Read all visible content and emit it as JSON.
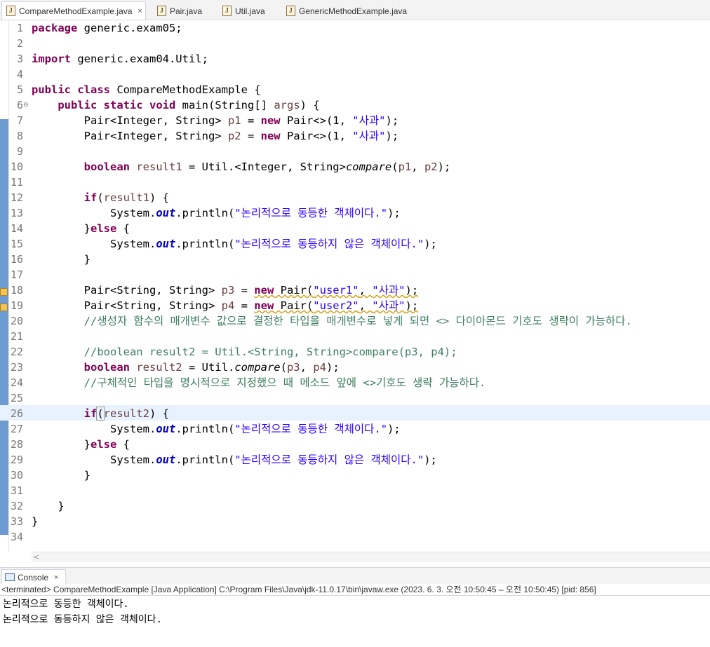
{
  "tabs": [
    {
      "label": "CompareMethodExample.java",
      "active": true,
      "close": "×"
    },
    {
      "label": "Pair.java",
      "active": false
    },
    {
      "label": "Util.java",
      "active": false
    },
    {
      "label": "GenericMethodExample.java",
      "active": false
    }
  ],
  "editor": {
    "line_numbers": [
      "1",
      "2",
      "3",
      "4",
      "5",
      "6",
      "7",
      "8",
      "9",
      "10",
      "11",
      "12",
      "13",
      "14",
      "15",
      "16",
      "17",
      "18",
      "19",
      "20",
      "21",
      "22",
      "23",
      "24",
      "25",
      "26",
      "27",
      "28",
      "29",
      "30",
      "31",
      "32",
      "33",
      "34"
    ],
    "code": {
      "l1_kw": "package",
      "l1_rest": " generic.exam05;",
      "l3_kw": "import",
      "l3_rest": " generic.exam04.Util;",
      "l5_kw1": "public",
      "l5_kw2": "class",
      "l5_rest": " CompareMethodExample {",
      "l6_kw1": "public",
      "l6_kw2": "static",
      "l6_kw3": "void",
      "l6_rest1": " main(String[] ",
      "l6_args": "args",
      "l6_rest2": ") {",
      "l7_a": "Pair<Integer, String> ",
      "l7_var": "p1",
      "l7_b": " = ",
      "l7_kw": "new",
      "l7_c": " Pair<>(1, ",
      "l7_str": "\"사과\"",
      "l7_d": ");",
      "l8_a": "Pair<Integer, String> ",
      "l8_var": "p2",
      "l8_b": " = ",
      "l8_kw": "new",
      "l8_c": " Pair<>(1, ",
      "l8_str": "\"사과\"",
      "l8_d": ");",
      "l10_kw": "boolean",
      "l10_var": " result1",
      "l10_a": " = Util.<Integer, String>",
      "l10_m": "compare",
      "l10_b": "(",
      "l10_p1": "p1",
      "l10_c": ", ",
      "l10_p2": "p2",
      "l10_d": ");",
      "l12_kw": "if",
      "l12_a": "(",
      "l12_var": "result1",
      "l12_b": ") {",
      "l13_a": "System.",
      "l13_f": "out",
      "l13_b": ".println(",
      "l13_str": "\"논리적으로 동등한 객체이다.\"",
      "l13_c": ");",
      "l14_a": "}",
      "l14_kw": "else",
      "l14_b": " {",
      "l15_a": "System.",
      "l15_f": "out",
      "l15_b": ".println(",
      "l15_str": "\"논리적으로 동등하지 않은 객체이다.\"",
      "l15_c": ");",
      "l16": "}",
      "l18_a": "Pair<String, String> ",
      "l18_var": "p3",
      "l18_b": " = ",
      "l18_kw": "new",
      "l18_c": " Pair(",
      "l18_s1": "\"user1\"",
      "l18_d": ", ",
      "l18_s2": "\"사과\"",
      "l18_e": ");",
      "l19_a": "Pair<String, String> ",
      "l19_var": "p4",
      "l19_b": " = ",
      "l19_kw": "new",
      "l19_c": " Pair(",
      "l19_s1": "\"user2\"",
      "l19_d": ", ",
      "l19_s2": "\"사과\"",
      "l19_e": ");",
      "l20_cm": "//생성자 함수의 매개변수 값으로 결정한 타입을 매개변수로 넣게 되면 <> 다이아몬드 기호도 생략이 가능하다.",
      "l22_cm": "//boolean result2 = Util.<String, String>compare(p3, p4);",
      "l23_kw": "boolean",
      "l23_var": " result2",
      "l23_a": " = Util.",
      "l23_m": "compare",
      "l23_b": "(",
      "l23_p1": "p3",
      "l23_c": ", ",
      "l23_p2": "p4",
      "l23_d": ");",
      "l24_cm": "//구체적인 타입을 명시적으로 지정했으 때 메소드 앞에 <>기호도 생략 가능하다.",
      "l26_kw": "if",
      "l26_a": "(",
      "l26_var": "result2",
      "l26_b": ") {",
      "l27_a": "System.",
      "l27_f": "out",
      "l27_b": ".println(",
      "l27_str": "\"논리적으로 동등한 객체이다.\"",
      "l27_c": ");",
      "l28_a": "}",
      "l28_kw": "else",
      "l28_b": " {",
      "l29_a": "System.",
      "l29_f": "out",
      "l29_b": ".println(",
      "l29_str": "\"논리적으로 동등하지 않은 객체이다.\"",
      "l29_c": ");",
      "l30": "}",
      "l32": "}",
      "l33": "}"
    }
  },
  "console": {
    "tab_label": "Console",
    "close": "×",
    "status": "<terminated> CompareMethodExample [Java Application] C:\\Program Files\\Java\\jdk-11.0.17\\bin\\javaw.exe  (2023. 6. 3. 오전 10:50:45 – 오전 10:50:45) [pid: 856]",
    "output": [
      "논리적으로 동등한 객체이다.",
      "논리적으로 동등하지 않은 객체이다."
    ]
  },
  "colors": {
    "keyword": "#7f0055",
    "string": "#2a00ff",
    "comment": "#3f7f5f",
    "field": "#0000c0",
    "current_line": "#e8f2fe"
  },
  "icons": {
    "java_file": "java-file-icon",
    "console": "console-icon",
    "warning": "warning-icon",
    "fold": "fold-collapse-icon"
  }
}
